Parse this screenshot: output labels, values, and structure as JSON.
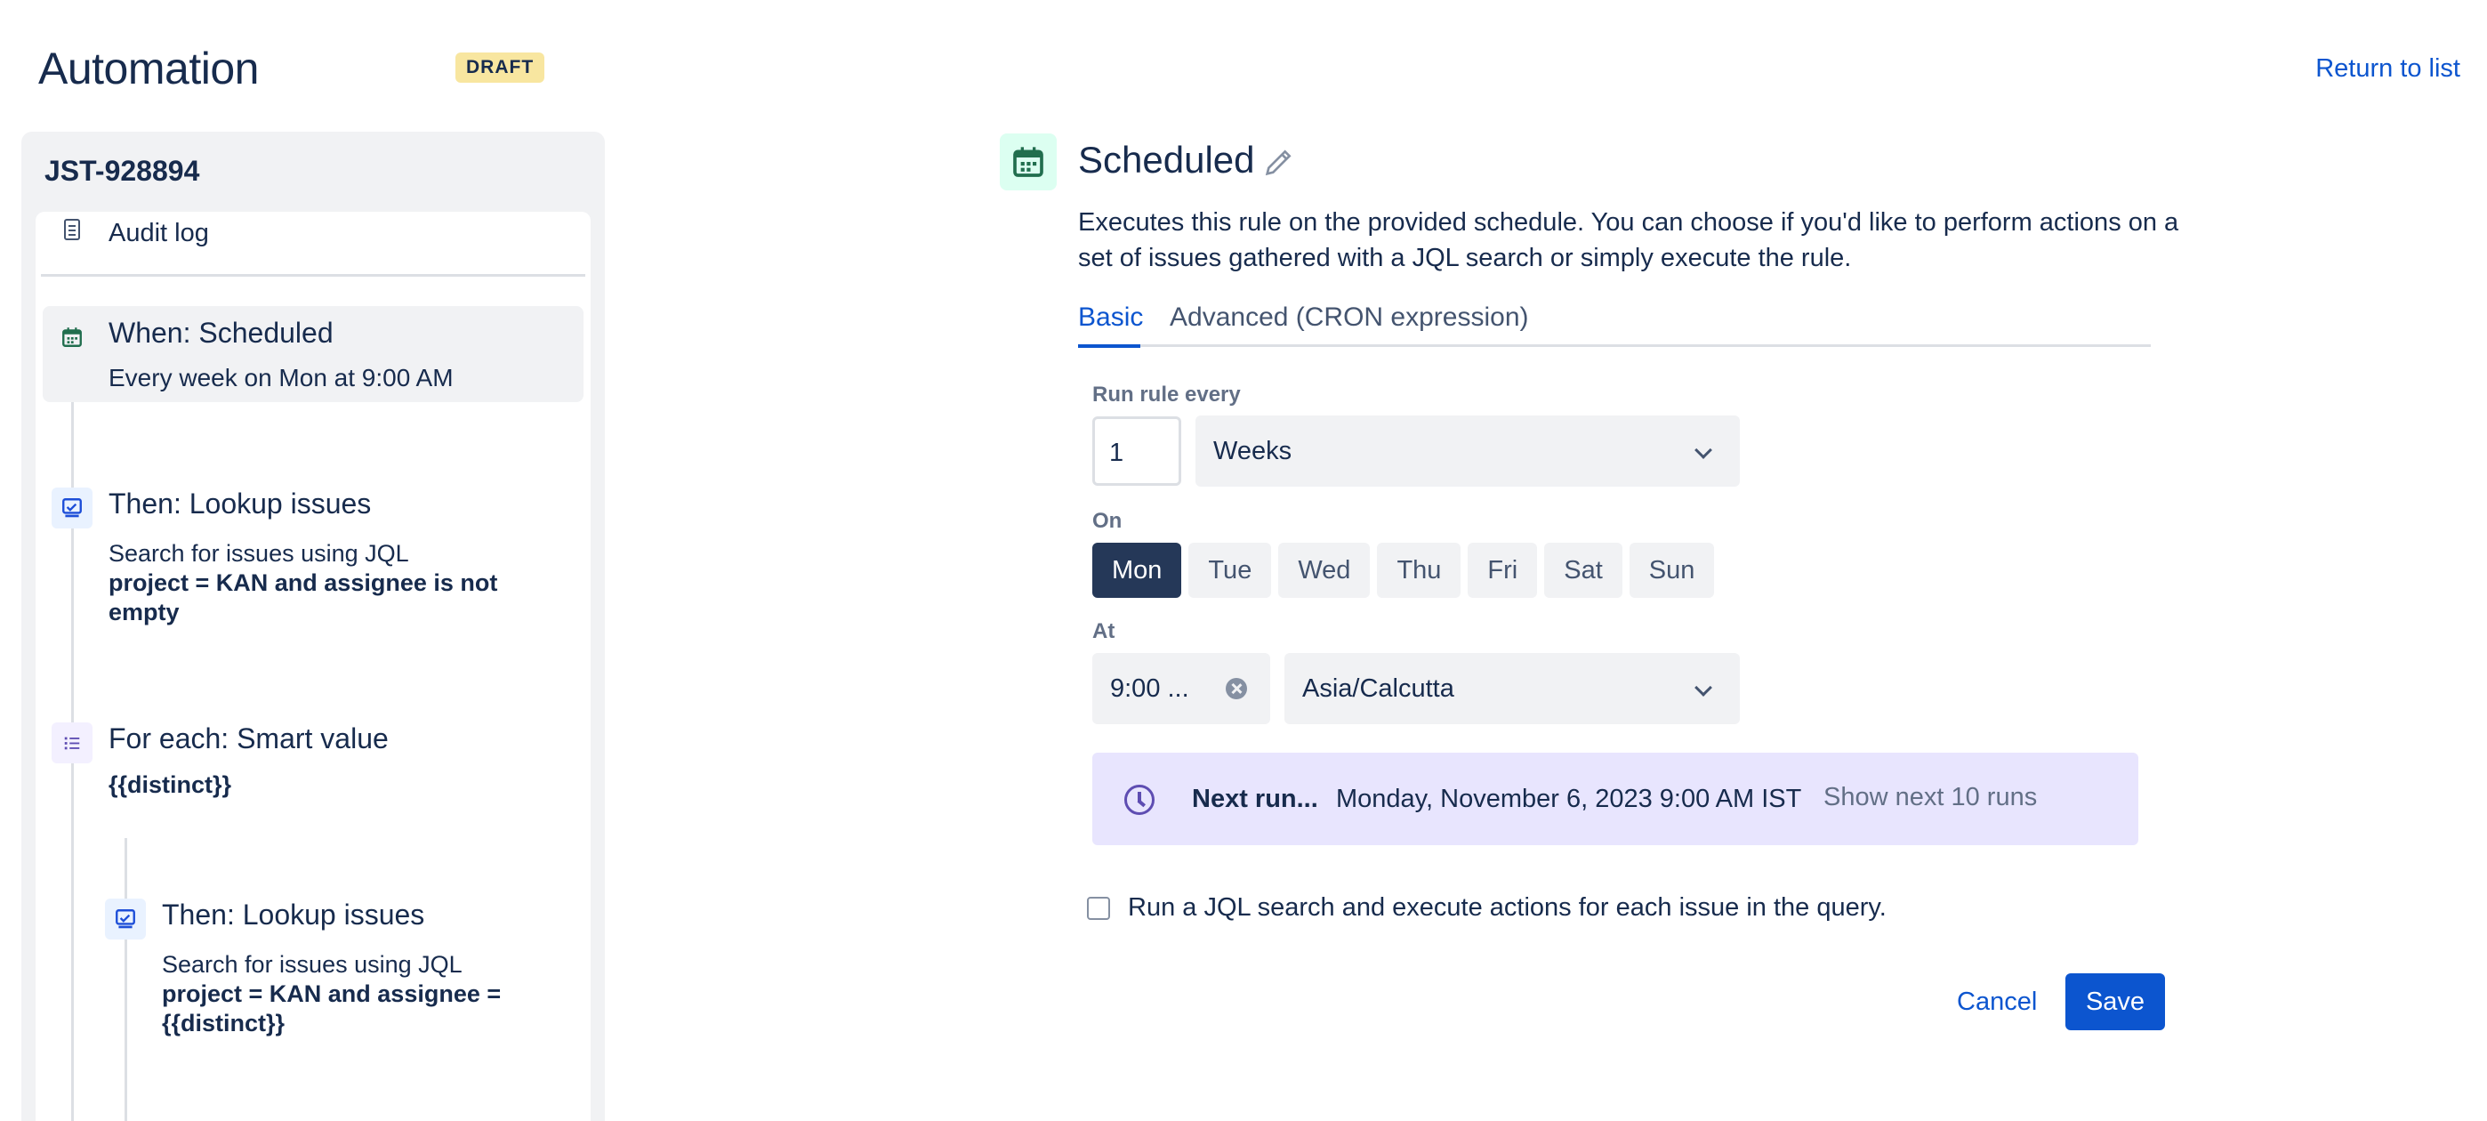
{
  "header": {
    "title": "Automation",
    "badge": "DRAFT",
    "return_link": "Return to list"
  },
  "rule": {
    "id": "JST-928894",
    "audit_log_label": "Audit log",
    "steps": [
      {
        "title": "When: Scheduled",
        "desc": "Every week on Mon at 9:00 AM",
        "icon": "calendar-icon"
      },
      {
        "title": "Then: Lookup issues",
        "desc": "Search for issues using JQL",
        "desc_bold": "project = KAN and assignee is not empty",
        "icon": "lookup-icon"
      },
      {
        "title": "For each: Smart value",
        "desc_bold": "{{distinct}}",
        "icon": "list-icon"
      },
      {
        "title": "Then: Lookup issues",
        "desc": "Search for issues using JQL",
        "desc_bold": "project = KAN and assignee = {{distinct}}",
        "icon": "lookup-icon"
      }
    ]
  },
  "trigger": {
    "title": "Scheduled",
    "description": "Executes this rule on the provided schedule. You can choose if you'd like to perform actions on a set of issues gathered with a JQL search or simply execute the rule.",
    "tabs": [
      {
        "label": "Basic",
        "active": true
      },
      {
        "label": "Advanced (CRON expression)",
        "active": false
      }
    ],
    "run_every_label": "Run rule every",
    "run_every_value": "1",
    "unit_value": "Weeks",
    "on_label": "On",
    "days": [
      {
        "label": "Mon",
        "selected": true
      },
      {
        "label": "Tue",
        "selected": false
      },
      {
        "label": "Wed",
        "selected": false
      },
      {
        "label": "Thu",
        "selected": false
      },
      {
        "label": "Fri",
        "selected": false
      },
      {
        "label": "Sat",
        "selected": false
      },
      {
        "label": "Sun",
        "selected": false
      }
    ],
    "at_label": "At",
    "time_value": "9:00 ...",
    "timezone_value": "Asia/Calcutta",
    "next_run_label": "Next run...",
    "next_run_value": "Monday, November 6, 2023 9:00 AM IST",
    "show_next_runs": "Show next 10 runs",
    "jql_checkbox_label": "Run a JQL search and execute actions for each issue in the query.",
    "jql_checkbox_checked": false
  },
  "footer": {
    "cancel_label": "Cancel",
    "save_label": "Save"
  },
  "colors": {
    "accent": "#0c55cf",
    "badge_bg": "#f8e6a0",
    "selected_day": "#253858",
    "next_run_bg": "#e8e5fe",
    "trigger_icon_bg": "#dcfff1",
    "trigger_icon": "#216e4e"
  }
}
